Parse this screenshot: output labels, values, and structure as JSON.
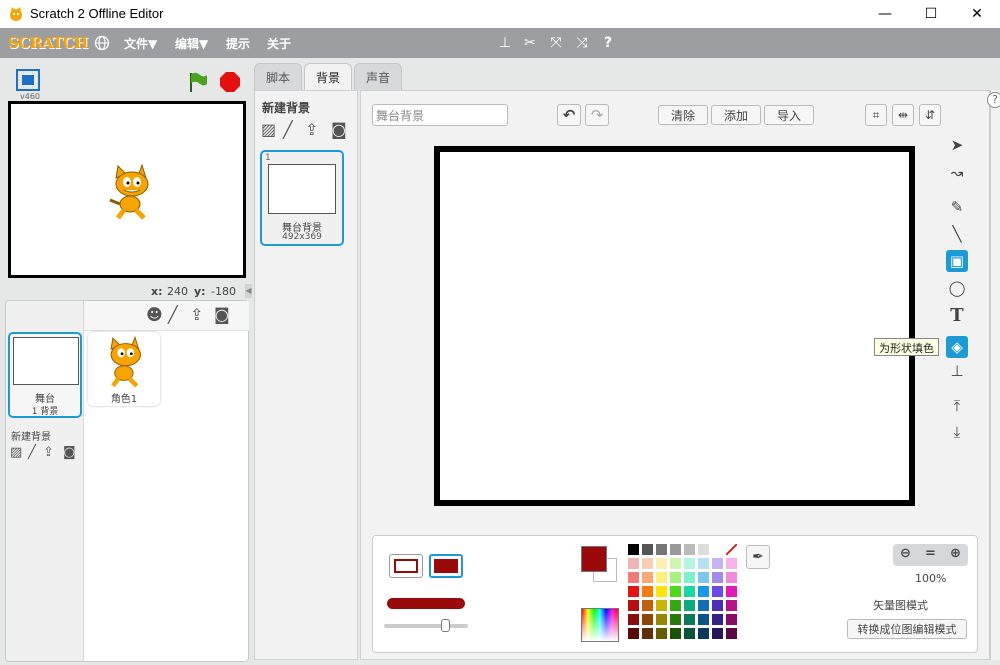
{
  "window": {
    "title": "Scratch 2 Offline Editor",
    "controls": [
      "—",
      "☐",
      "✕"
    ]
  },
  "menubar": {
    "logo": "SCRATCH",
    "items": [
      "文件▼",
      "编辑▼",
      "提示",
      "关于"
    ]
  },
  "stage": {
    "version": "v460",
    "coords": {
      "x_label": "x:",
      "x_value": "240",
      "y_label": "y:",
      "y_value": "-180"
    }
  },
  "sprites": {
    "stage_card": {
      "name": "舞台",
      "subtitle": "1 背景"
    },
    "sprite_card": {
      "name": "角色1"
    },
    "new_backdrop_label": "新建背景"
  },
  "tabs": [
    "脚本",
    "背景",
    "声音"
  ],
  "backdrop_list": {
    "title": "新建背景",
    "items": [
      {
        "index": "1",
        "name": "舞台背景",
        "size": "492x369"
      }
    ]
  },
  "editor": {
    "name_value": "舞台背景",
    "buttons": [
      "清除",
      "添加",
      "导入"
    ],
    "tooltip": "为形状填色",
    "zoom": "100%",
    "mode_text": "矢量图模式",
    "convert_button": "转换成位图编辑模式"
  },
  "colors": {
    "accent": "#1b9ad6",
    "selected_color": "#9b0a0a",
    "palette": [
      [
        "#000000",
        "#555555",
        "#777777",
        "#999999",
        "#bbbbbb",
        "#dddddd",
        "#ffffff",
        "none"
      ],
      [
        "#f2b3b3",
        "#f7cfb3",
        "#fbf0b3",
        "#d0f5b3",
        "#b3f5e3",
        "#b3e0f5",
        "#c6b3f5",
        "#f5b3e8"
      ],
      [
        "#f47a7a",
        "#f8aa72",
        "#fff07a",
        "#a6f27a",
        "#7af2cf",
        "#7ac8f2",
        "#a08af2",
        "#f28ad9"
      ],
      [
        "#e81212",
        "#f57a10",
        "#ffe600",
        "#4cd917",
        "#17d9a6",
        "#1798e8",
        "#6a4ae8",
        "#e818b8"
      ],
      [
        "#b80e0e",
        "#c25f0a",
        "#c9b500",
        "#35a80f",
        "#0fa87f",
        "#0f70b8",
        "#4a2fb8",
        "#b80f8c"
      ],
      [
        "#8a0b0b",
        "#8f4507",
        "#968700",
        "#267a0b",
        "#0b7a5c",
        "#0b5288",
        "#352188",
        "#8a0b67"
      ],
      [
        "#5c0707",
        "#612f05",
        "#665c00",
        "#1a5308",
        "#08533f",
        "#08385c",
        "#24165c",
        "#5c0744"
      ]
    ]
  }
}
